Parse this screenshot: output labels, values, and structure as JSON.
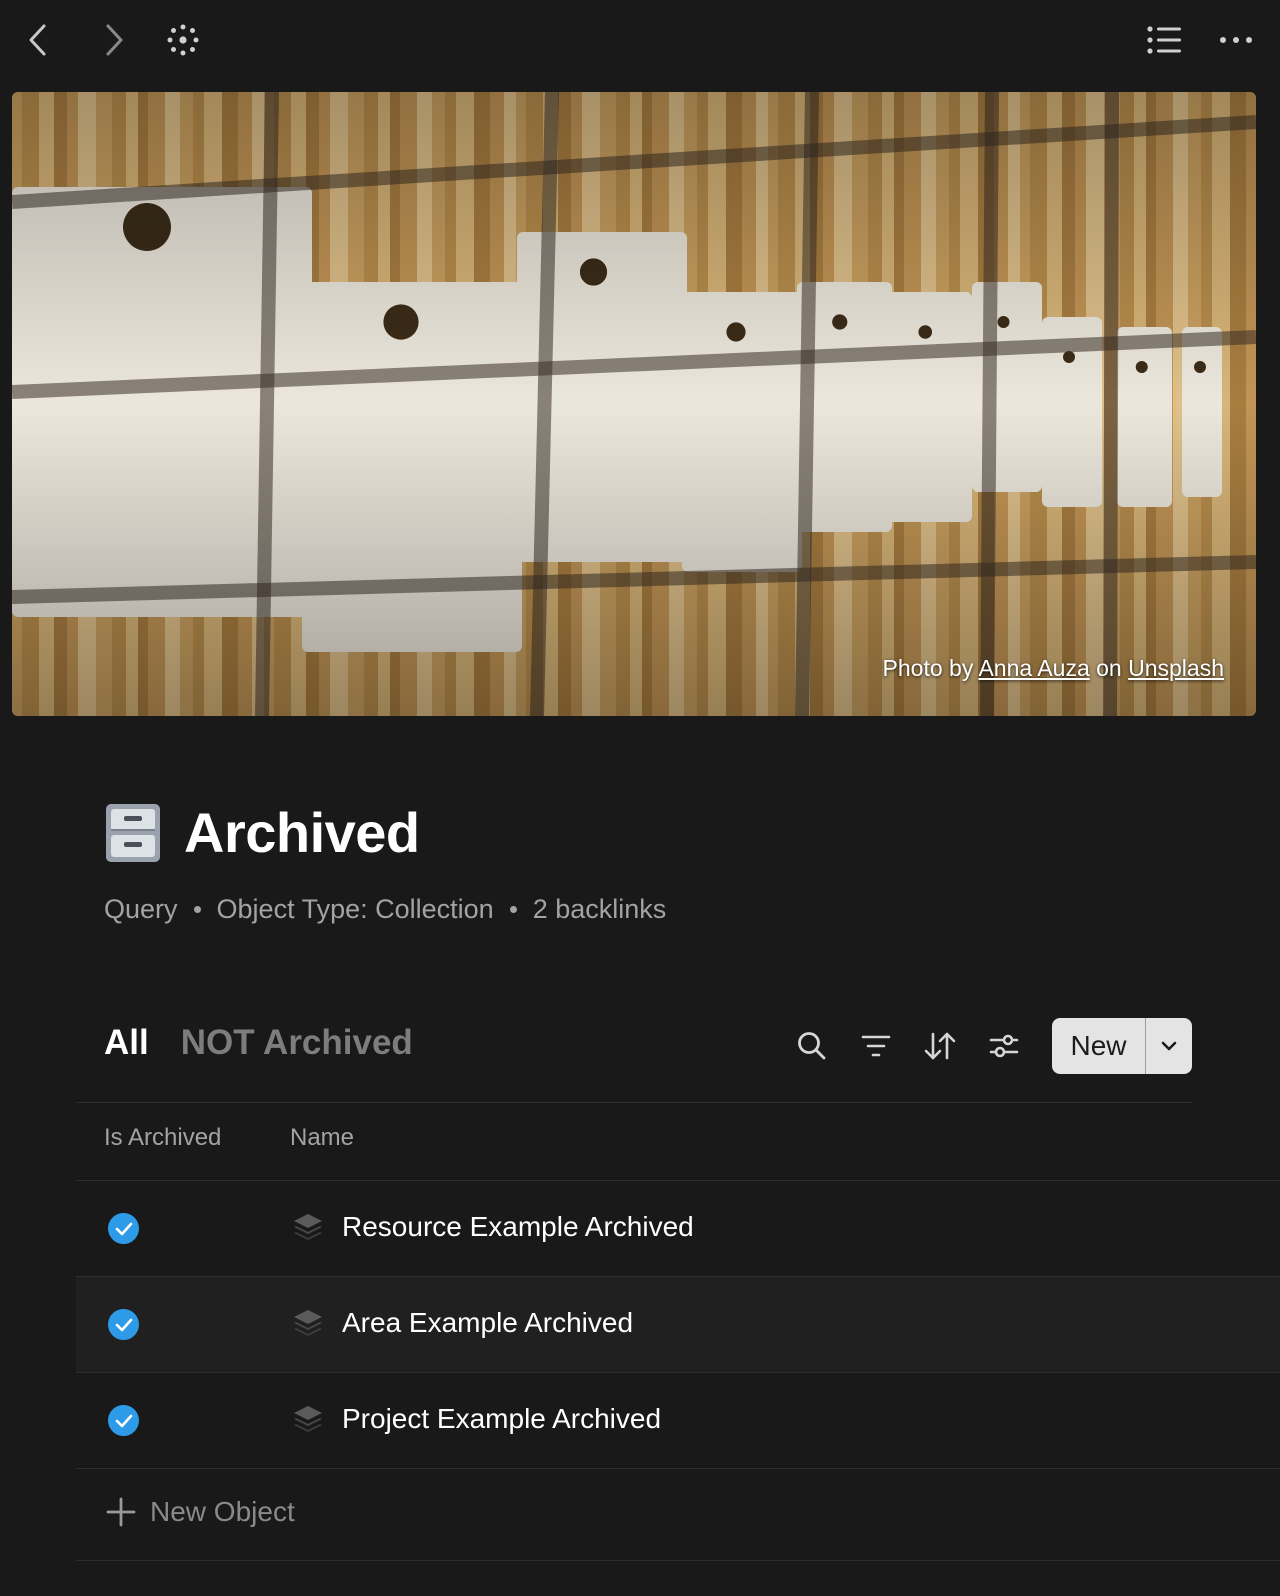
{
  "nav": {
    "back_icon": "chevron-left-icon",
    "forward_icon": "chevron-right-icon",
    "graph_icon": "graph-dots-icon",
    "outline_icon": "list-icon",
    "more_icon": "ellipsis-icon"
  },
  "cover": {
    "credit_prefix": "Photo by",
    "credit_author": "Anna Auza",
    "credit_middle": "on",
    "credit_source": "Unsplash"
  },
  "page": {
    "icon": "file-cabinet-icon",
    "title": "Archived",
    "meta": [
      "Query",
      "Object Type: Collection",
      "2 backlinks"
    ]
  },
  "view": {
    "tabs": [
      {
        "label": "All",
        "active": true
      },
      {
        "label": "NOT Archived",
        "active": false
      }
    ],
    "new_label": "New"
  },
  "table": {
    "columns": [
      "Is Archived",
      "Name"
    ],
    "rows": [
      {
        "is_archived": true,
        "name": "Resource Example Archived"
      },
      {
        "is_archived": true,
        "name": "Area Example Archived"
      },
      {
        "is_archived": true,
        "name": "Project Example Archived"
      }
    ],
    "new_object_label": "New Object"
  },
  "colors": {
    "background": "#191919",
    "check": "#2d9be8",
    "button": "#e4e4e4"
  }
}
